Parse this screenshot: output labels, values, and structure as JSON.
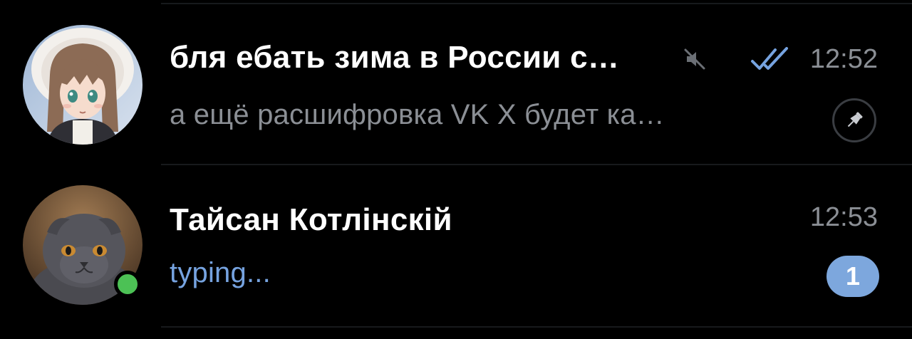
{
  "chats": [
    {
      "title": "бля ебать зима в России с…",
      "preview": "а ещё расшифровка VK X будет ка…",
      "time": "12:52",
      "muted": true,
      "read_status": "read",
      "pinned": true,
      "avatar": "anime-girl-winter-hood-avatar"
    },
    {
      "title": "Тайсан Котлінскій",
      "preview": "typing...",
      "time": "12:53",
      "online": true,
      "unread_count": "1",
      "avatar": "grey-cat-avatar"
    }
  ],
  "colors": {
    "background": "#000000",
    "title": "#ffffff",
    "secondary_text": "#8b8f95",
    "accent_blue": "#76a3e0",
    "unread_badge": "#7da7dd",
    "online": "#4cc155"
  },
  "icons": {
    "mute": "muted-speaker-icon",
    "read": "double-check-icon",
    "pin": "pin-icon"
  }
}
